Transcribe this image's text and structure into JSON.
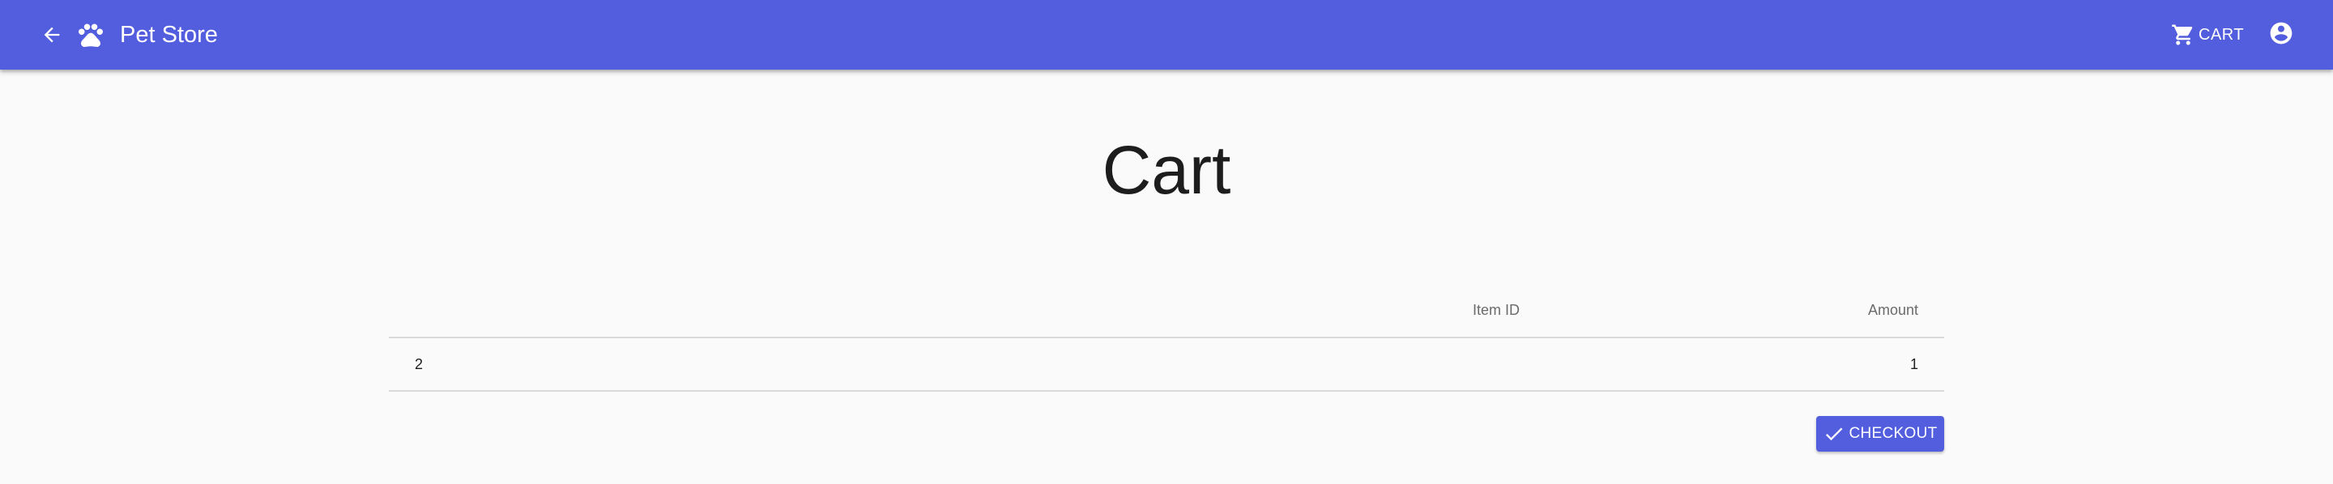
{
  "header": {
    "title": "Pet Store",
    "back_icon": "arrow-left-icon",
    "logo_icon": "paw-icon",
    "cart_label": "CART",
    "cart_icon": "cart-icon",
    "account_icon": "account-circle-icon",
    "background_color": "#535ede"
  },
  "page": {
    "title": "Cart"
  },
  "table": {
    "columns": [
      "",
      "Item ID",
      "Amount"
    ],
    "rows": [
      [
        "2",
        "",
        "1"
      ]
    ]
  },
  "actions": {
    "checkout_label": "CHECKOUT",
    "checkout_icon": "check-icon"
  }
}
